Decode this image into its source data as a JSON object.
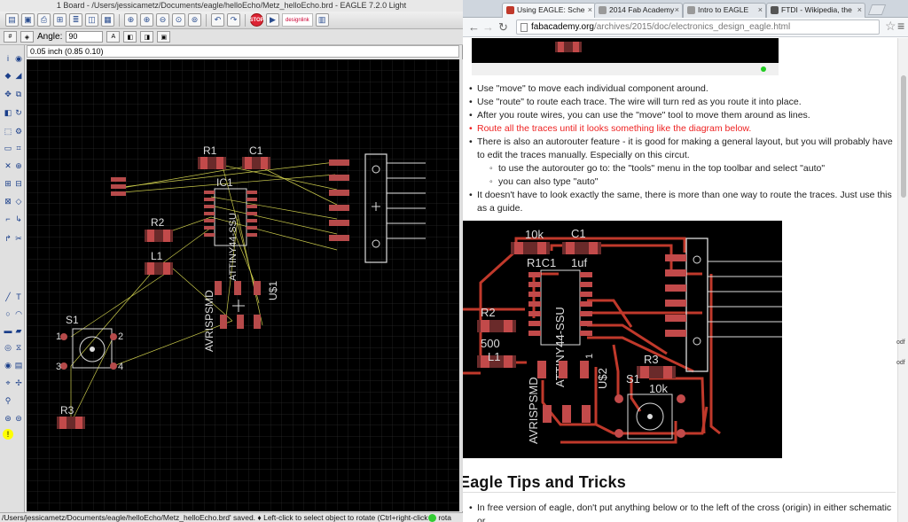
{
  "eagle": {
    "window_title": "1 Board - /Users/jessicametz/Documents/eagle/helloEcho/Metz_helloEcho.brd - EAGLE 7.2.0 Light",
    "toolbar_badge": "designlink",
    "param": {
      "angle_label": "Angle:",
      "angle_value": "90"
    },
    "coord_readout": "0.05 inch (0.85 0.10)",
    "status": "/Users/jessicametz/Documents/eagle/helloEcho/Metz_helloEcho.brd' saved.  ♦ Left-click to select object to rotate (Ctrl+right-click to rota",
    "board_labels": {
      "r1": "R1",
      "c1": "C1",
      "ic1": "IC1",
      "ic_part": "ATTINY44-SSU",
      "r2": "R2",
      "l1": "L1",
      "s1": "S1",
      "r3": "R3",
      "avrisp": "AVRISPSMD",
      "usb": "U$1",
      "pin1": "1",
      "pin2": "2",
      "pin3": "3",
      "pin4": "4"
    }
  },
  "browser": {
    "tabs": [
      {
        "label": "Using EAGLE: Sche",
        "icon_color": "#c0392b"
      },
      {
        "label": "2014 Fab Academy",
        "icon_color": "#999999"
      },
      {
        "label": "Intro to EAGLE",
        "icon_color": "#999999"
      },
      {
        "label": "FTDI - Wikipedia, the",
        "icon_color": "#555555"
      }
    ],
    "url_host": "fabacademy.org",
    "url_path": "/archives/2015/doc/electronics_design_eagle.html",
    "steps": [
      "Use \"move\" to move each individual component around.",
      "Use \"route\" to route each trace. The wire will turn red as you route it into place.",
      "After you route wires, you can use the \"move\" tool to move them around as lines.",
      "Route all the traces until it looks something like the diagram below.",
      "There is also an autorouter feature - it is good for making a general layout, but you will probably have to edit the traces manually. Especially on this circut.",
      "to use the autorouter go to: the \"tools\" menu in the top toolbar and select \"auto\"",
      "you can also type \"auto\"",
      "It doesn't have to look exactly the same, there is more than one way to route the traces. Just use this as a guide."
    ],
    "pcb_labels": {
      "r10k": "10k",
      "c1": "C1",
      "ric1": "R1C1",
      "uf": "1uf",
      "r2": "R2",
      "v500": "500",
      "l1": "L1",
      "ic": "ATTINY44-SSU",
      "r3": "R3",
      "s1": "S1",
      "k10": "10k",
      "usb": "U$2",
      "one": "1",
      "avrisp": "AVRISPSMD"
    },
    "tips_heading": "Eagle Tips and Tricks",
    "tips": [
      "In free version of eagle, don't put anything below or to the left of the cross (origin) in either schematic or"
    ],
    "peek_text": [
      "odf",
      "odf"
    ]
  }
}
